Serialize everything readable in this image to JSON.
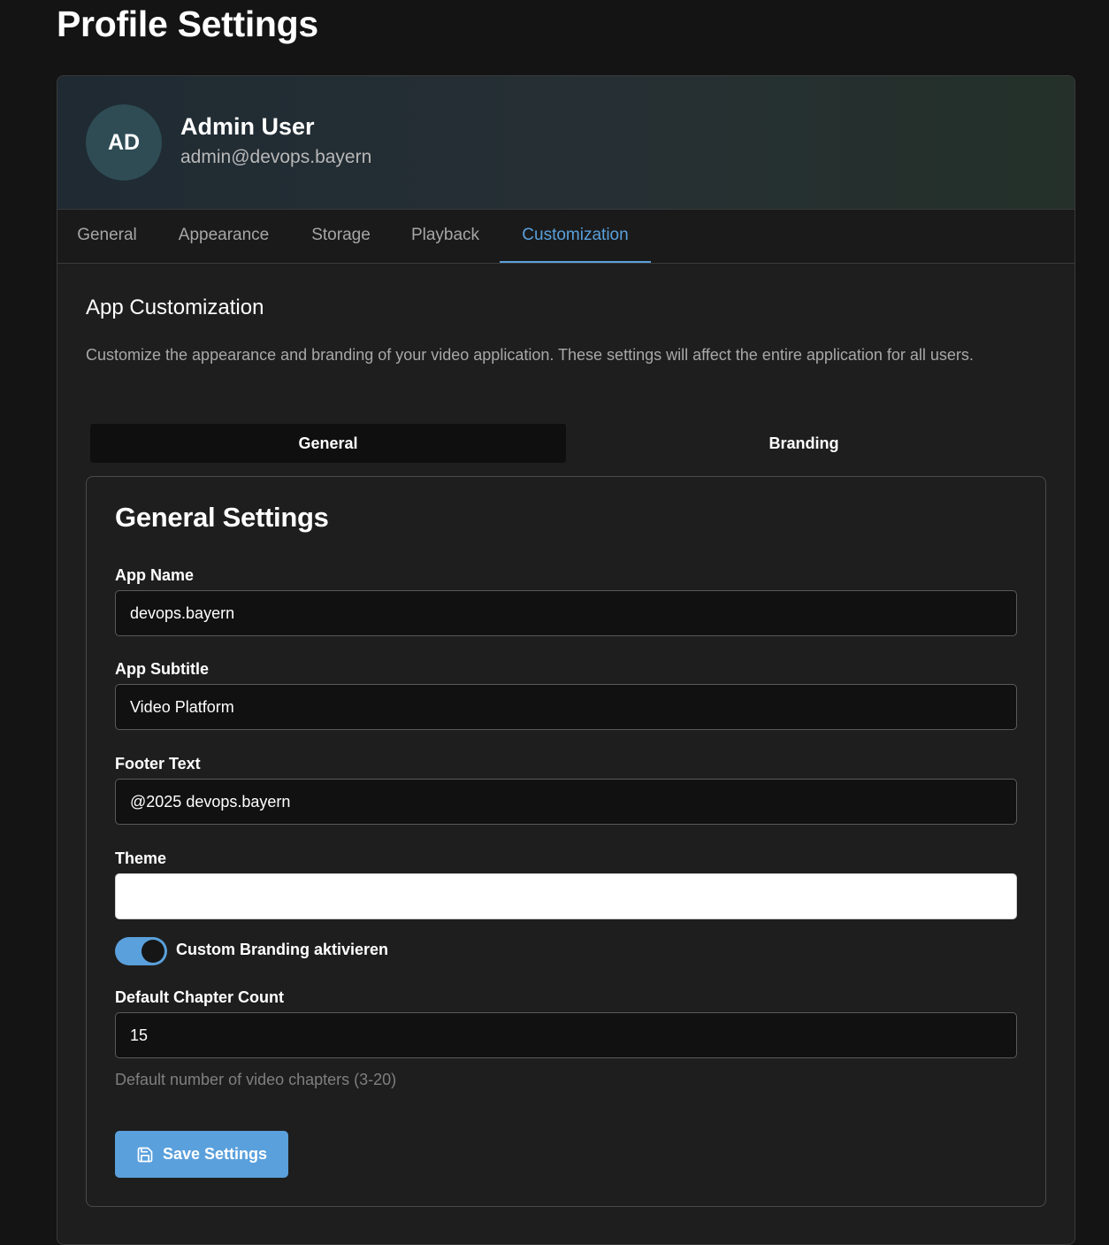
{
  "page": {
    "title": "Profile Settings"
  },
  "profile": {
    "avatar_initials": "AD",
    "name": "Admin User",
    "email": "admin@devops.bayern"
  },
  "tabs": [
    {
      "label": "General",
      "active": false
    },
    {
      "label": "Appearance",
      "active": false
    },
    {
      "label": "Storage",
      "active": false
    },
    {
      "label": "Playback",
      "active": false
    },
    {
      "label": "Customization",
      "active": true
    }
  ],
  "customization": {
    "title": "App Customization",
    "description": "Customize the appearance and branding of your video application. These settings will affect the entire application for all users.",
    "subtabs": [
      {
        "label": "General",
        "active": true
      },
      {
        "label": "Branding",
        "active": false
      }
    ]
  },
  "general_settings": {
    "title": "General Settings",
    "app_name": {
      "label": "App Name",
      "value": "devops.bayern"
    },
    "app_subtitle": {
      "label": "App Subtitle",
      "value": "Video Platform"
    },
    "footer_text": {
      "label": "Footer Text",
      "value": "@2025 devops.bayern"
    },
    "theme": {
      "label": "Theme",
      "value": ""
    },
    "custom_branding": {
      "label": "Custom Branding aktivieren",
      "enabled": true
    },
    "chapter_count": {
      "label": "Default Chapter Count",
      "value": "15",
      "help": "Default number of video chapters (3-20)"
    },
    "save_label": "Save Settings",
    "save_icon": "save-icon"
  },
  "colors": {
    "accent": "#5aa0dc",
    "background": "#141414",
    "card": "#1e1e1e"
  }
}
